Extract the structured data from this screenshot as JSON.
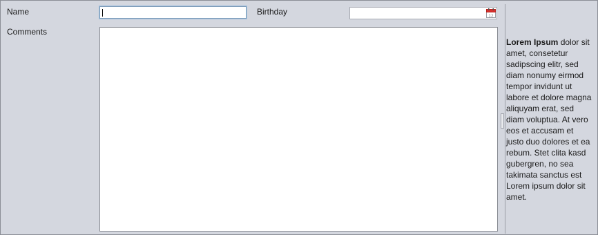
{
  "form": {
    "name_label": "Name",
    "name_value": "",
    "birthday_label": "Birthday",
    "birthday_value": "",
    "comments_label": "Comments",
    "comments_value": "",
    "calendar_icon": "calendar-icon",
    "calendar_icon_day": "12"
  },
  "sidebar": {
    "lead_bold": "Lorem Ipsum",
    "body": " dolor sit amet, consetetur sadipscing elitr, sed diam nonumy eirmod tempor invidunt ut labore et dolore magna aliquyam erat, sed diam voluptua. At vero eos et accusam et justo duo dolores et ea rebum. Stet clita kasd gubergren, no sea takimata sanctus est Lorem ipsum dolor sit amet."
  },
  "colors": {
    "panel_background": "#d4d7df",
    "focus_ring": "#9fc0de",
    "calendar_accent": "#d9302c"
  }
}
